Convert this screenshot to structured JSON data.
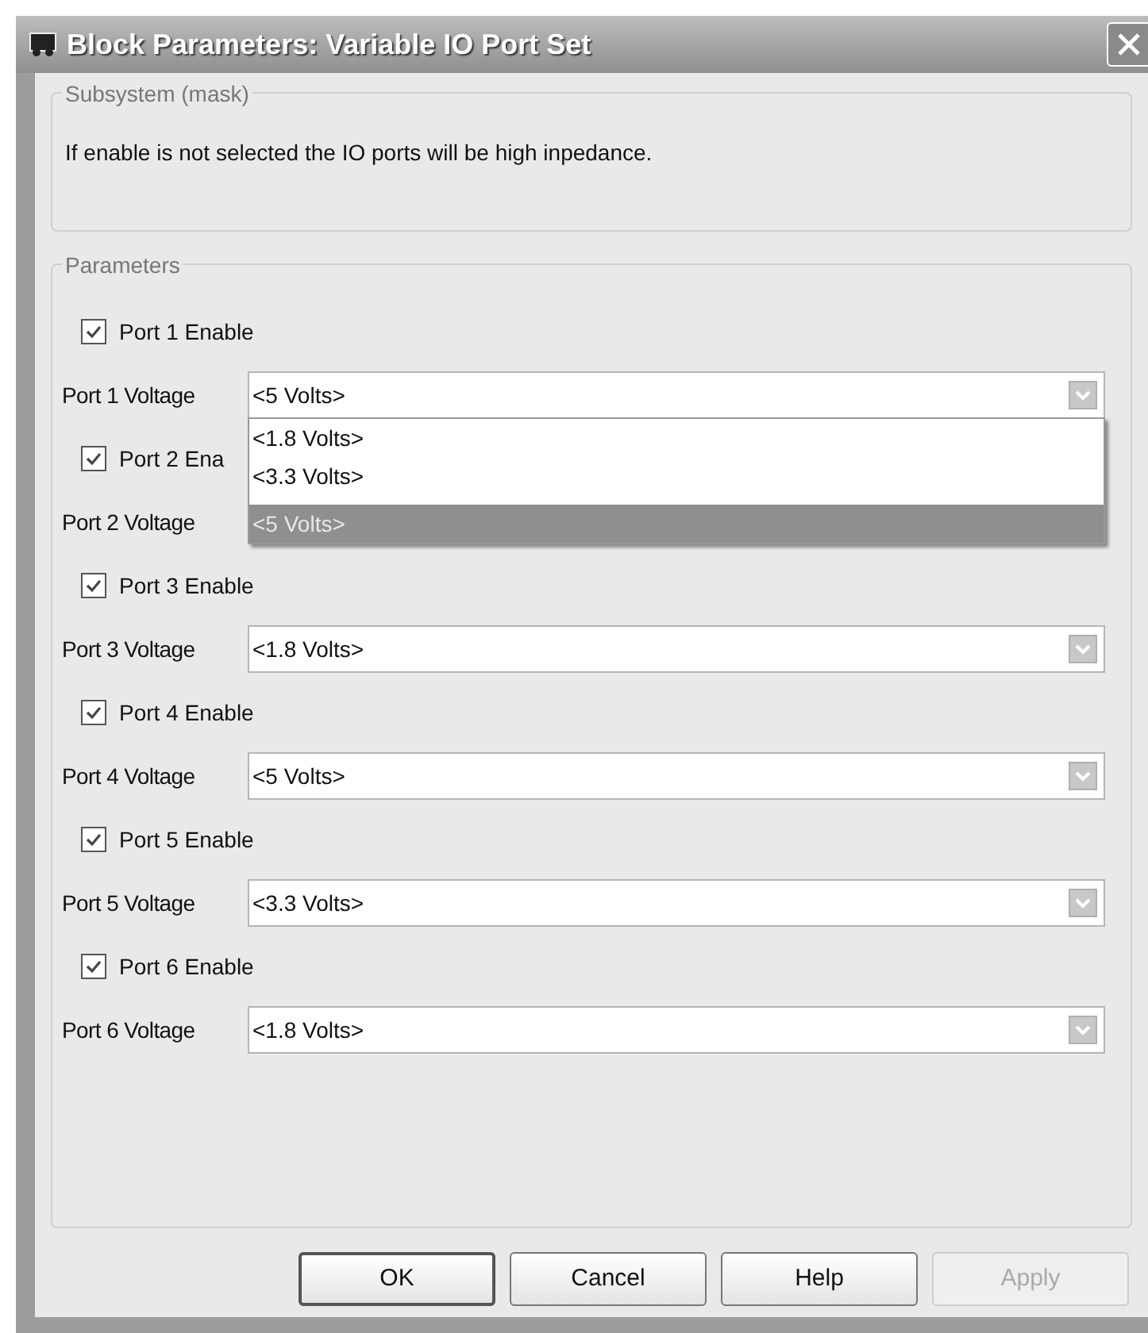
{
  "window": {
    "title": "Block Parameters: Variable IO Port Set"
  },
  "mask": {
    "legend": "Subsystem (mask)",
    "description": "If enable is not selected the IO ports will be high inpedance."
  },
  "parameters": {
    "legend": "Parameters",
    "ports": [
      {
        "enable_label": "Port 1 Enable",
        "checked": true,
        "voltage_label": "Port 1 Voltage",
        "value": "<5 Volts>",
        "options": [
          {
            "label": "<1.8 Volts>",
            "selected": false
          },
          {
            "label": "<3.3 Volts>",
            "selected": false
          },
          {
            "label": "<5 Volts>",
            "selected": true
          }
        ]
      },
      {
        "enable_label": "Port 2 Ena",
        "checked": true,
        "voltage_label": "Port 2 Voltage"
      },
      {
        "enable_label": "Port 3 Enable",
        "checked": true,
        "voltage_label": "Port 3 Voltage",
        "value": "<1.8 Volts>"
      },
      {
        "enable_label": "Port 4 Enable",
        "checked": true,
        "voltage_label": "Port 4 Voltage",
        "value": "<5 Volts>"
      },
      {
        "enable_label": "Port 5 Enable",
        "checked": true,
        "voltage_label": "Port 5 Voltage",
        "value": "<3.3 Volts>"
      },
      {
        "enable_label": "Port 6 Enable",
        "checked": true,
        "voltage_label": "Port 6 Voltage",
        "value": "<1.8 Volts>"
      }
    ]
  },
  "buttons": [
    {
      "label": "OK",
      "default": true,
      "disabled": false
    },
    {
      "label": "Cancel",
      "default": false,
      "disabled": false
    },
    {
      "label": "Help",
      "default": false,
      "disabled": false
    },
    {
      "label": "Apply",
      "default": false,
      "disabled": true
    }
  ]
}
